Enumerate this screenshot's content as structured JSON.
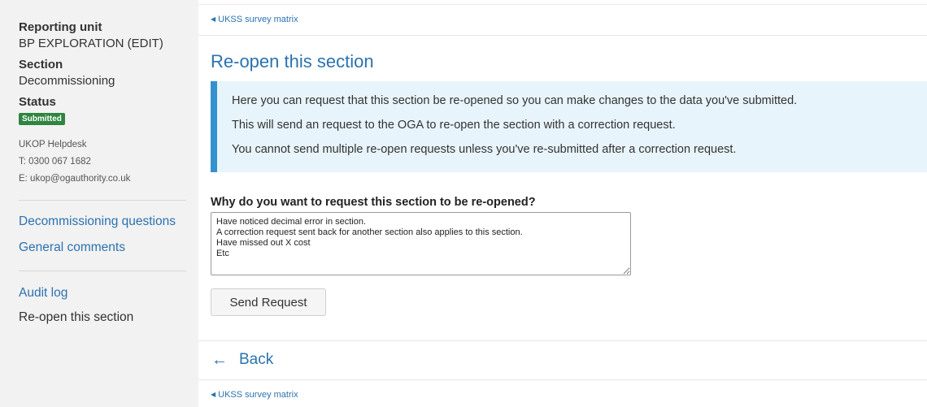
{
  "sidebar": {
    "reporting_unit_label": "Reporting unit",
    "reporting_unit_value": "BP EXPLORATION (EDIT)",
    "section_label": "Section",
    "section_value": "Decommissioning",
    "status_label": "Status",
    "status_badge": "Submitted",
    "helpdesk": {
      "name": "UKOP Helpdesk",
      "phone": "T: 0300 067 1682",
      "email": "E: ukop@ogauthority.co.uk"
    },
    "nav": [
      {
        "label": "Decommissioning questions"
      },
      {
        "label": "General comments"
      }
    ],
    "audit_log": "Audit log",
    "current_page": "Re-open this section"
  },
  "breadcrumb": {
    "label": "UKSS survey matrix",
    "arrow_icon": "triangle-left-icon"
  },
  "page_title": "Re-open this section",
  "info_panel": {
    "lines": [
      "Here you can request that this section be re-opened so you can make changes to the data you've submitted.",
      "This will send an request to the OGA to re-open the section with a correction request.",
      "You cannot send multiple re-open requests unless you've re-submitted after a correction request."
    ]
  },
  "form": {
    "question": "Why do you want to request this section to be re-opened?",
    "answer": "Have noticed decimal error in section.\nA correction request sent back for another section also applies to this section.\nHave missed out X cost\nEtc",
    "submit_label": "Send Request"
  },
  "back_link": {
    "label": "Back",
    "icon": "arrow-left-icon"
  },
  "colors": {
    "link": "#2b72b0",
    "status_green": "#2e8540",
    "info_bg": "#e8f4fb",
    "info_border": "#3391cf",
    "sidebar_bg": "#f2f2f2"
  }
}
